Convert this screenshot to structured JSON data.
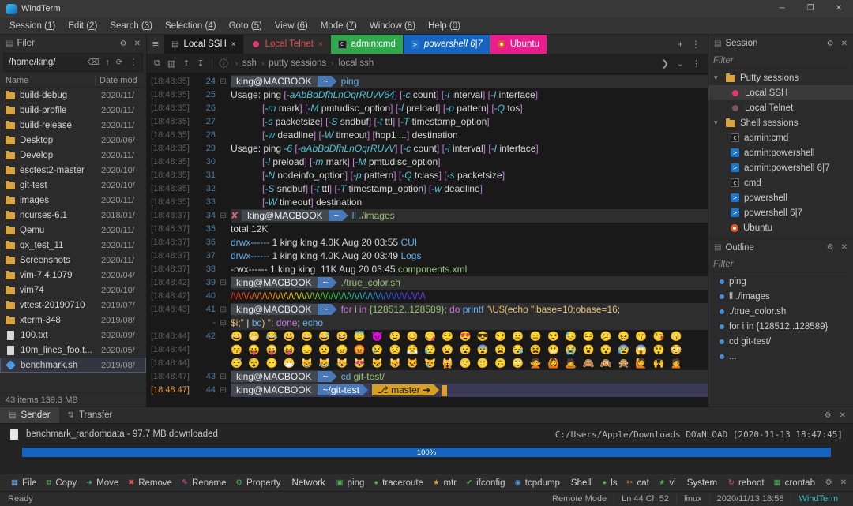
{
  "titlebar": {
    "title": "WindTerm",
    "controls": {
      "minimize": "─",
      "maximize": "❐",
      "close": "✕"
    }
  },
  "menubar": {
    "items": [
      {
        "label": "Session",
        "accel": "1"
      },
      {
        "label": "Edit",
        "accel": "2"
      },
      {
        "label": "Search",
        "accel": "3"
      },
      {
        "label": "Selection",
        "accel": "4"
      },
      {
        "label": "Goto",
        "accel": "5"
      },
      {
        "label": "View",
        "accel": "6"
      },
      {
        "label": "Mode",
        "accel": "7"
      },
      {
        "label": "Window",
        "accel": "8"
      },
      {
        "label": "Help",
        "accel": "0"
      }
    ]
  },
  "filer": {
    "title": "Filer",
    "header_icon": "▤",
    "gear_icon": "⚙",
    "close_icon": "✕",
    "path": "/home/king/",
    "path_icons": [
      {
        "name": "back-icon",
        "glyph": "⌫"
      },
      {
        "name": "up-icon",
        "glyph": "↑"
      },
      {
        "name": "refresh-icon",
        "glyph": "⟳"
      },
      {
        "name": "more-icon",
        "glyph": "⋮"
      }
    ],
    "columns": {
      "name": "Name",
      "date": "Date mod"
    },
    "items": [
      {
        "name": "build-debug",
        "date": "2020/11/",
        "icon": "folder"
      },
      {
        "name": "build-profile",
        "date": "2020/11/",
        "icon": "folder"
      },
      {
        "name": "build-release",
        "date": "2020/11/",
        "icon": "folder"
      },
      {
        "name": "Desktop",
        "date": "2020/06/",
        "icon": "folder"
      },
      {
        "name": "Develop",
        "date": "2020/11/",
        "icon": "folder"
      },
      {
        "name": "esctest2-master",
        "date": "2020/10/",
        "icon": "folder"
      },
      {
        "name": "git-test",
        "date": "2020/10/",
        "icon": "folder"
      },
      {
        "name": "images",
        "date": "2020/11/",
        "icon": "folder"
      },
      {
        "name": "ncurses-6.1",
        "date": "2018/01/",
        "icon": "folder"
      },
      {
        "name": "Qemu",
        "date": "2020/11/",
        "icon": "folder"
      },
      {
        "name": "qx_test_11",
        "date": "2020/11/",
        "icon": "folder"
      },
      {
        "name": "Screenshots",
        "date": "2020/11/",
        "icon": "folder"
      },
      {
        "name": "vim-7.4.1079",
        "date": "2020/04/",
        "icon": "folder"
      },
      {
        "name": "vim74",
        "date": "2020/10/",
        "icon": "folder"
      },
      {
        "name": "vttest-20190710",
        "date": "2019/07/",
        "icon": "folder"
      },
      {
        "name": "xterm-348",
        "date": "2019/08/",
        "icon": "folder"
      },
      {
        "name": "100.txt",
        "date": "2020/09/",
        "icon": "file"
      },
      {
        "name": "10m_lines_foo.t...",
        "date": "2020/05/",
        "icon": "file"
      },
      {
        "name": "benchmark.sh",
        "date": "2019/08/",
        "icon": "script",
        "selected": true
      }
    ],
    "status": "43 items 139.3 MB"
  },
  "tab_bar": {
    "menu_icon": "≣",
    "tabs": [
      {
        "label": "Local SSH",
        "type": "active",
        "icon": "terminal",
        "close": "×"
      },
      {
        "label": "Local Telnet",
        "type": "telnet",
        "icon": "dot-red",
        "close": "×"
      },
      {
        "label": "admin:cmd",
        "type": "cmd",
        "icon": "cmd"
      },
      {
        "label": "powershell 6|7",
        "type": "ps",
        "icon": "ps"
      },
      {
        "label": "Ubuntu",
        "type": "ubuntu",
        "icon": "ubuntu"
      }
    ],
    "new_tab": "+",
    "more": "⋮"
  },
  "terminal_toolbar": {
    "left_icons": [
      {
        "name": "copy-icon",
        "glyph": "⧉"
      },
      {
        "name": "layout-icon",
        "glyph": "▥"
      },
      {
        "name": "upload-icon",
        "glyph": "↥"
      },
      {
        "name": "download-icon",
        "glyph": "↧"
      }
    ],
    "info_icon": "ⓘ",
    "breadcrumb": [
      "ssh",
      "putty sessions",
      "local ssh"
    ],
    "breadcrumb_sep": "›",
    "right_icons": [
      {
        "name": "expand-icon",
        "glyph": "❯"
      },
      {
        "name": "chevron-down-icon",
        "glyph": "⌄"
      },
      {
        "name": "more-icon",
        "glyph": "⋮"
      }
    ]
  },
  "terminal": {
    "lines": [
      {
        "time": "[18:48:35]",
        "num": "24",
        "fold": "⊟",
        "type": "prompt",
        "hl": true,
        "user": "king@MACBOOK",
        "path": "~",
        "segments": [
          {
            "t": "ping",
            "c": "c-b"
          }
        ]
      },
      {
        "time": "[18:48:35]",
        "num": "25",
        "type": "usage",
        "text": "Usage: ping [-aAbBdDfhLnOqrRUvV64] [-c count] [-i interval] [-I interface]"
      },
      {
        "time": "[18:48:35]",
        "num": "26",
        "type": "usage",
        "text": "            [-m mark] [-M pmtudisc_option] [-l preload] [-p pattern] [-Q tos]"
      },
      {
        "time": "[18:48:35]",
        "num": "27",
        "type": "usage",
        "text": "            [-s packetsize] [-S sndbuf] [-t ttl] [-T timestamp_option]"
      },
      {
        "time": "[18:48:35]",
        "num": "28",
        "type": "usage",
        "text": "            [-w deadline] [-W timeout] [hop1 ...] destination"
      },
      {
        "time": "[18:48:35]",
        "num": "29",
        "type": "usage",
        "text": "Usage: ping -6 [-aAbBdDfhLnOqrRUvV] [-c count] [-i interval] [-I interface]"
      },
      {
        "time": "[18:48:35]",
        "num": "30",
        "type": "usage",
        "text": "            [-l preload] [-m mark] [-M pmtudisc_option]"
      },
      {
        "time": "[18:48:35]",
        "num": "31",
        "type": "usage",
        "text": "            [-N nodeinfo_option] [-p pattern] [-Q tclass] [-s packetsize]"
      },
      {
        "time": "[18:48:35]",
        "num": "32",
        "type": "usage",
        "text": "            [-S sndbuf] [-t ttl] [-T timestamp_option] [-w deadline]"
      },
      {
        "time": "[18:48:35]",
        "num": "33",
        "type": "usage",
        "text": "            [-W timeout] destination"
      },
      {
        "time": "[18:48:37]",
        "num": "34",
        "fold": "⊟",
        "type": "prompt",
        "hl": true,
        "error": "✘",
        "user": "king@MACBOOK",
        "path": "~",
        "segments": [
          {
            "t": "ll",
            "c": "c-b"
          },
          {
            "t": " ./images",
            "c": "c-g"
          }
        ]
      },
      {
        "time": "[18:48:37]",
        "num": "35",
        "segments": [
          {
            "t": "total 12K",
            "c": "c-w"
          }
        ]
      },
      {
        "time": "[18:48:37]",
        "num": "36",
        "segments": [
          {
            "t": "drwx------",
            "c": "c-b"
          },
          {
            "t": " 1 king king 4.0K Aug 20 03:55 ",
            "c": "c-w"
          },
          {
            "t": "CUI",
            "c": "c-b"
          }
        ]
      },
      {
        "time": "[18:48:37]",
        "num": "37",
        "segments": [
          {
            "t": "drwx------",
            "c": "c-b"
          },
          {
            "t": " 1 king king 4.0K Aug 20 03:49 ",
            "c": "c-w"
          },
          {
            "t": "Logs",
            "c": "c-b"
          }
        ]
      },
      {
        "time": "[18:48:37]",
        "num": "38",
        "segments": [
          {
            "t": "-rwx------ 1 king king  11K Aug 20 03:45 ",
            "c": "c-w"
          },
          {
            "t": "components.xml",
            "c": "c-g"
          }
        ]
      },
      {
        "time": "[18:48:42]",
        "num": "39",
        "fold": "⊟",
        "type": "prompt",
        "hl": true,
        "user": "king@MACBOOK",
        "path": "~",
        "segments": [
          {
            "t": "./true_color.sh",
            "c": "c-g"
          }
        ]
      },
      {
        "time": "[18:48:42]",
        "num": "40",
        "type": "rainbow",
        "pattern": "/\\",
        "count": 37
      },
      {
        "time": "[18:48:43]",
        "num": "41",
        "fold": "⊟",
        "type": "prompt",
        "hl": true,
        "user": "king@MACBOOK",
        "path": "~",
        "segments": [
          {
            "t": "for",
            "c": "c-m"
          },
          {
            "t": " i ",
            "c": "c-w"
          },
          {
            "t": "in",
            "c": "c-m"
          },
          {
            "t": " {128512..128589}",
            "c": "c-g"
          },
          {
            "t": "; ",
            "c": "c-w"
          },
          {
            "t": "do",
            "c": "c-m"
          },
          {
            "t": " printf ",
            "c": "c-b"
          },
          {
            "t": "\"\\U$(echo \"ibase=10;obase=16;",
            "c": "c-y"
          }
        ]
      },
      {
        "time": "",
        "num": "-",
        "fold": "⊟",
        "hl": true,
        "segments": [
          {
            "t": "$i;\" ",
            "c": "c-y"
          },
          {
            "t": "| ",
            "c": "c-w"
          },
          {
            "t": "bc",
            "c": "c-b"
          },
          {
            "t": ") \"",
            "c": "c-y"
          },
          {
            "t": "; ",
            "c": "c-w"
          },
          {
            "t": "done",
            "c": "c-m"
          },
          {
            "t": "; ",
            "c": "c-w"
          },
          {
            "t": "echo",
            "c": "c-b"
          }
        ]
      },
      {
        "time": "[18:48:44]",
        "num": "42",
        "type": "emoji",
        "text": "😀 😁 😂 😃 😄 😅 😆 😇 😈 😉 😊 😋 😌 😍 😎 😏 😐 😑 😒 😓 😔 😕 😖 😗 😘 😙"
      },
      {
        "time": "[18:48:44]",
        "num": "",
        "type": "emoji",
        "text": "😚 😛 😜 😝 😞 😟 😠 😡 😢 😣 😤 😥 😦 😧 😨 😩 😪 😫 😬 😭 😮 😯 😰 😱 😲 😳"
      },
      {
        "time": "[18:48:44]",
        "num": "",
        "type": "emoji",
        "text": "😴 😵 😶 😷 😸 😹 😺 😻 😼 😽 😾 😿 🙀 🙁 🙂 🙃 🙄 🙅 🙆 🙇 🙈 🙉 🙊 🙋 🙌 🙍"
      },
      {
        "time": "[18:48:47]",
        "num": "43",
        "fold": "⊟",
        "type": "prompt",
        "hl": true,
        "user": "king@MACBOOK",
        "path": "~",
        "segments": [
          {
            "t": "cd",
            "c": "c-b"
          },
          {
            "t": " git-test/",
            "c": "c-g"
          }
        ]
      },
      {
        "time": "[18:48:47]",
        "num": "44",
        "fold": "⊟",
        "type": "prompt",
        "sel": true,
        "user": "king@MACBOOK",
        "path": "~/git-test",
        "badge": "⎇ master ➜",
        "cursor": true,
        "segments": []
      }
    ]
  },
  "session_panel": {
    "title": "Session",
    "header_icon": "▤",
    "gear_icon": "⚙",
    "close_icon": "✕",
    "filter_placeholder": "Filter",
    "tree": [
      {
        "label": "Putty sessions",
        "kind": "group",
        "icon": "folder"
      },
      {
        "label": "Local SSH",
        "kind": "item",
        "icon": "dot-red",
        "selected": true
      },
      {
        "label": "Local Telnet",
        "kind": "item",
        "icon": "dot-dark"
      },
      {
        "label": "Shell sessions",
        "kind": "group",
        "icon": "folder"
      },
      {
        "label": "admin:cmd",
        "kind": "item",
        "icon": "cmd"
      },
      {
        "label": "admin:powershell",
        "kind": "item",
        "icon": "ps"
      },
      {
        "label": "admin:powershell 6|7",
        "kind": "item",
        "icon": "ps"
      },
      {
        "label": "cmd",
        "kind": "item",
        "icon": "cmd"
      },
      {
        "label": "powershell",
        "kind": "item",
        "icon": "ps"
      },
      {
        "label": "powershell 6|7",
        "kind": "item",
        "icon": "ps"
      },
      {
        "label": "Ubuntu",
        "kind": "item",
        "icon": "ubuntu"
      }
    ]
  },
  "outline_panel": {
    "title": "Outline",
    "gear_icon": "⚙",
    "close_icon": "✕",
    "filter_placeholder": "Filter",
    "items": [
      "ping",
      "ll ./images",
      "./true_color.sh",
      "for i in {128512..128589}",
      "cd git-test/",
      "..."
    ]
  },
  "transfer": {
    "tabs": [
      {
        "label": "Sender",
        "icon": "▤",
        "active": true
      },
      {
        "label": "Transfer",
        "icon": "⇅"
      }
    ],
    "gear_icon": "⚙",
    "close_icon": "✕",
    "file": "benchmark_randomdata - 97.7 MB downloaded",
    "destination": "C:/Users/Apple/Downloads DOWNLOAD [2020-11-13 18:47:45]",
    "progress": "100%"
  },
  "quickbar": {
    "items": [
      {
        "icon": "▦",
        "color": "#6ea8e0",
        "label": "File"
      },
      {
        "icon": "⧉",
        "color": "#4db354",
        "label": "Copy"
      },
      {
        "icon": "➜",
        "color": "#4db3a0",
        "label": "Move"
      },
      {
        "icon": "✖",
        "color": "#e05555",
        "label": "Remove"
      },
      {
        "icon": "✎",
        "color": "#e0559a",
        "label": "Rename"
      },
      {
        "icon": "⚙",
        "color": "#4db354",
        "label": "Property"
      },
      {
        "label": "Network",
        "group": true
      },
      {
        "icon": "▣",
        "color": "#4db354",
        "label": "ping"
      },
      {
        "icon": "●",
        "color": "#4db354",
        "label": "traceroute"
      },
      {
        "icon": "★",
        "color": "#e0b432",
        "label": "mtr"
      },
      {
        "icon": "✔",
        "color": "#4db354",
        "label": "ifconfig"
      },
      {
        "icon": "◉",
        "color": "#4d9ae0",
        "label": "tcpdump"
      },
      {
        "label": "Shell",
        "group": true
      },
      {
        "icon": "●",
        "color": "#4db354",
        "label": "ls"
      },
      {
        "icon": "✂",
        "color": "#e08a32",
        "label": "cat"
      },
      {
        "icon": "★",
        "color": "#4db354",
        "label": "vi"
      },
      {
        "label": "System",
        "group": true
      },
      {
        "icon": "↻",
        "color": "#e05555",
        "label": "reboot"
      },
      {
        "icon": "▦",
        "color": "#4db354",
        "label": "crontab"
      }
    ],
    "gear_icon": "⚙",
    "close_icon": "✕"
  },
  "statusbar": {
    "left": "Ready",
    "items": [
      "Remote Mode",
      "Ln 44 Ch 52",
      "linux",
      "2020/11/13 18:58",
      "WindTerm"
    ]
  }
}
